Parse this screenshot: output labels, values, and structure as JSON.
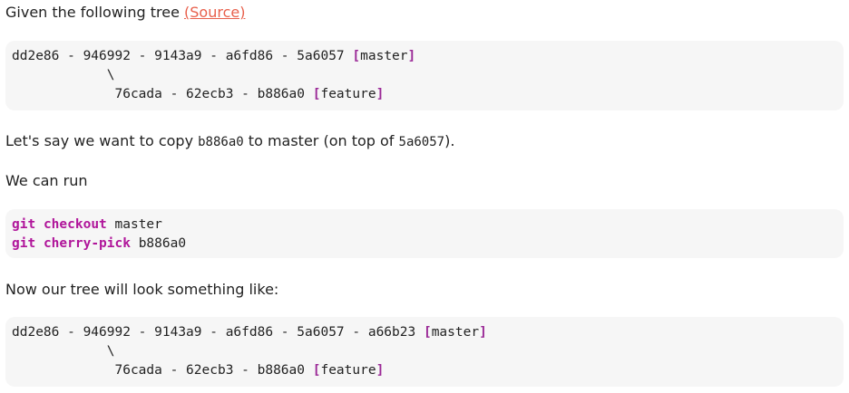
{
  "intro": {
    "text": "Given the following tree ",
    "link": "(Source)"
  },
  "tree_before": {
    "line1": "dd2e86 - 946992 - 9143a9 - a6fd86 - 5a6057 ",
    "line1_branch": "master",
    "line2": "            \\",
    "line3": "             76cada - 62ecb3 - b886a0 ",
    "line3_branch": "feature"
  },
  "explain": {
    "before": "Let's say we want to copy ",
    "commit": "b886a0",
    "middle": " to master (on top of ",
    "target": "5a6057",
    "after": ")."
  },
  "run_text": "We can run",
  "commands": [
    {
      "git": "git",
      "sub": "checkout",
      "arg": "master"
    },
    {
      "git": "git",
      "sub": "cherry-pick",
      "arg": "b886a0"
    }
  ],
  "after_text": "Now our tree will look something like:",
  "tree_after": {
    "line1": "dd2e86 - 946992 - 9143a9 - a6fd86 - 5a6057 - a66b23 ",
    "line1_branch": "master",
    "line2": "            \\",
    "line3": "             76cada - 62ecb3 - b886a0 ",
    "line3_branch": "feature"
  },
  "brackets": {
    "open": "[",
    "close": "]"
  }
}
